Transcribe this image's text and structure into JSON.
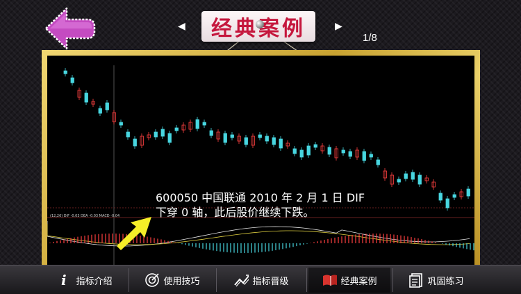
{
  "header": {
    "title": "经典案例",
    "page_indicator": "1/8",
    "colors": {
      "title": "#c5173d",
      "back_button": "#c44bc1"
    }
  },
  "chart_data": {
    "type": "candlestick",
    "annotation": "600050 中国联通 2010 年 2 月 1 日 DIF 下穿 0 轴，此后股价继续下跌。",
    "caption_line1": "600050 中国联通 2010 年 2 月 1 日 DIF",
    "caption_line2": "下穿 0 轴，此后股价继续下跌。",
    "macd_label": "(12,26) DIF -0.03 DEA -0.03 MACD -0.04",
    "colors": {
      "up": "#ff4040",
      "down": "#48d6e0",
      "dif": "#e8e8e8",
      "dea": "#e0d040",
      "arrow": "#f5ee28"
    }
  },
  "tabs": [
    {
      "label": "指标介绍",
      "icon": "info-icon",
      "active": false
    },
    {
      "label": "使用技巧",
      "icon": "target-icon",
      "active": false
    },
    {
      "label": "指标晋级",
      "icon": "level-up-icon",
      "active": false
    },
    {
      "label": "经典案例",
      "icon": "book-icon",
      "active": true
    },
    {
      "label": "巩固练习",
      "icon": "notes-icon",
      "active": false
    }
  ]
}
